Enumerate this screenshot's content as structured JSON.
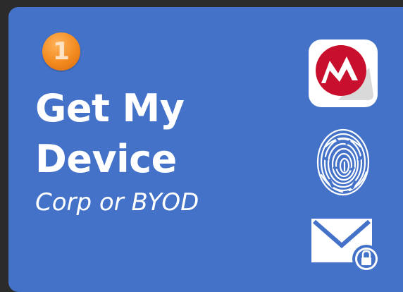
{
  "card": {
    "step_number": "1",
    "title_line1": "Get My",
    "title_line2": "Device",
    "subtitle": "Corp or BYOD"
  },
  "icons": {
    "step": "step-1-icon",
    "app": "mobileiron-app-icon",
    "fingerprint": "fingerprint-icon",
    "mail": "locked-mail-icon"
  },
  "colors": {
    "card_background": "#4472c8",
    "page_background": "#2b2b2b",
    "step_badge": "#f28a1f",
    "app_icon_red": "#c8102e",
    "text": "#ffffff"
  }
}
